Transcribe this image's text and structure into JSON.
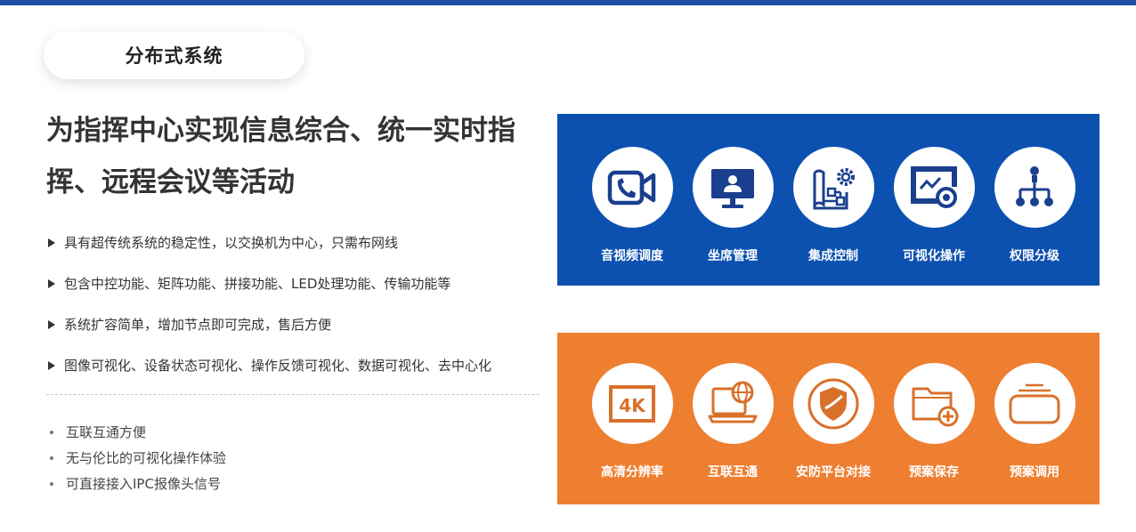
{
  "section_title": "分布式系统",
  "headline": "为指挥中心实现信息综合、统一实时指挥、远程会议等活动",
  "features": [
    "具有超传统系统的稳定性，以交换机为中心，只需布网线",
    "包含中控功能、矩阵功能、拼接功能、LED处理功能、传输功能等",
    "系统扩容简单，增加节点即可完成，售后方便",
    "图像可视化、设备状态可视化、操作反馈可视化、数据可视化、去中心化"
  ],
  "bullets": [
    "互联互通方便",
    "无与伦比的可视化操作体验",
    "可直接接入IPC报像头信号"
  ],
  "colors": {
    "top_bar": "#1f4fa3",
    "blue_panel": "#0c51b0",
    "orange_panel": "#ee7f31",
    "icon_blue": "#1a3f8f",
    "icon_orange": "#d9702a"
  },
  "blue_panel": {
    "items": [
      {
        "icon": "video-call-icon",
        "label": "音视频调度"
      },
      {
        "icon": "monitor-user-icon",
        "label": "坐席管理"
      },
      {
        "icon": "blueprint-gear-icon",
        "label": "集成控制"
      },
      {
        "icon": "chart-eye-icon",
        "label": "可视化操作"
      },
      {
        "icon": "hierarchy-icon",
        "label": "权限分级"
      }
    ]
  },
  "orange_panel": {
    "items": [
      {
        "icon": "4k-icon",
        "label": "高清分辨率",
        "icon_text": "4K"
      },
      {
        "icon": "laptop-globe-icon",
        "label": "互联互通"
      },
      {
        "icon": "shield-icon",
        "label": "安防平台对接"
      },
      {
        "icon": "folder-add-icon",
        "label": "预案保存"
      },
      {
        "icon": "tray-icon",
        "label": "预案调用"
      }
    ]
  }
}
